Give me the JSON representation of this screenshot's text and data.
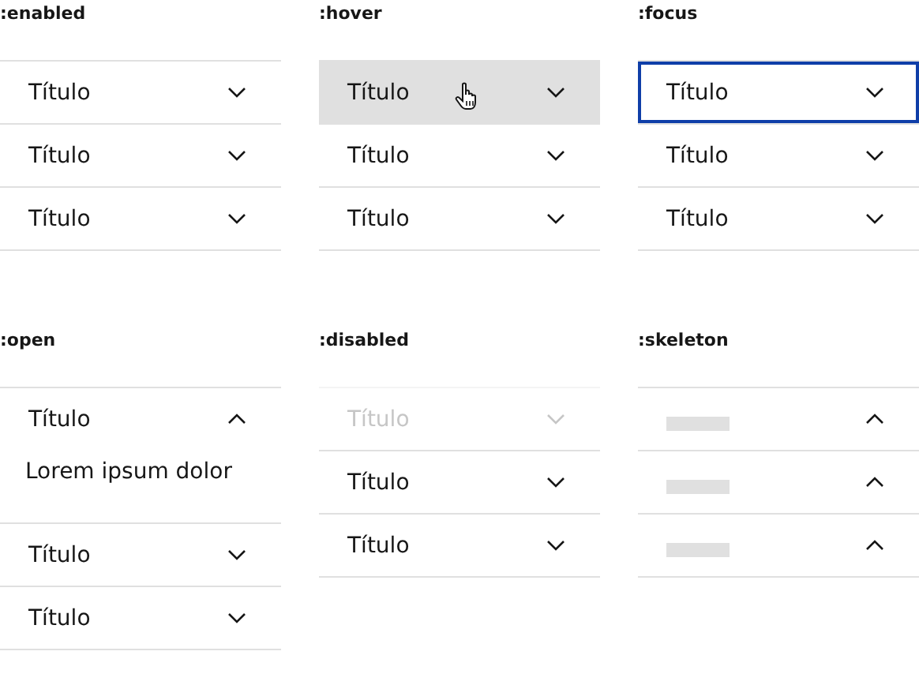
{
  "panels": [
    {
      "label": ":enabled",
      "items": [
        {
          "kind": "item",
          "title": "Título",
          "expanded": false,
          "disabled": false,
          "hovered": false,
          "focused": false
        },
        {
          "kind": "item",
          "title": "Título",
          "expanded": false,
          "disabled": false,
          "hovered": false,
          "focused": false
        },
        {
          "kind": "item",
          "title": "Título",
          "expanded": false,
          "disabled": false,
          "hovered": false,
          "focused": false
        }
      ]
    },
    {
      "label": ":hover",
      "items": [
        {
          "kind": "item",
          "title": "Título",
          "expanded": false,
          "disabled": false,
          "hovered": true,
          "focused": false
        },
        {
          "kind": "item",
          "title": "Título",
          "expanded": false,
          "disabled": false,
          "hovered": false,
          "focused": false
        },
        {
          "kind": "item",
          "title": "Título",
          "expanded": false,
          "disabled": false,
          "hovered": false,
          "focused": false
        }
      ]
    },
    {
      "label": ":focus",
      "items": [
        {
          "kind": "item",
          "title": "Título",
          "expanded": false,
          "disabled": false,
          "hovered": false,
          "focused": true
        },
        {
          "kind": "item",
          "title": "Título",
          "expanded": false,
          "disabled": false,
          "hovered": false,
          "focused": false
        },
        {
          "kind": "item",
          "title": "Título",
          "expanded": false,
          "disabled": false,
          "hovered": false,
          "focused": false
        }
      ]
    },
    {
      "label": ":open",
      "items": [
        {
          "kind": "item",
          "title": "Título",
          "content": "Lorem ipsum dolor",
          "expanded": true,
          "disabled": false,
          "hovered": false,
          "focused": false
        },
        {
          "kind": "item",
          "title": "Título",
          "expanded": false,
          "disabled": false,
          "hovered": false,
          "focused": false
        },
        {
          "kind": "item",
          "title": "Título",
          "expanded": false,
          "disabled": false,
          "hovered": false,
          "focused": false
        }
      ]
    },
    {
      "label": ":disabled",
      "items": [
        {
          "kind": "item",
          "title": "Título",
          "expanded": false,
          "disabled": true,
          "hovered": false,
          "focused": false
        },
        {
          "kind": "item",
          "title": "Título",
          "expanded": false,
          "disabled": false,
          "hovered": false,
          "focused": false
        },
        {
          "kind": "item",
          "title": "Título",
          "expanded": false,
          "disabled": false,
          "hovered": false,
          "focused": false
        }
      ]
    },
    {
      "label": ":skeleton",
      "items": [
        {
          "kind": "skeleton"
        },
        {
          "kind": "skeleton"
        },
        {
          "kind": "skeleton"
        }
      ]
    }
  ]
}
